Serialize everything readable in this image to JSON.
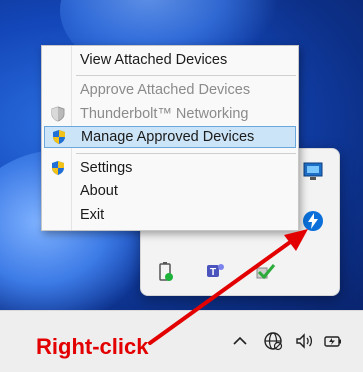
{
  "context_menu": {
    "items": [
      {
        "label": "View Attached Devices",
        "state": "enabled",
        "icon": null
      },
      {
        "label": "Approve Attached Devices",
        "state": "disabled",
        "icon": null
      },
      {
        "label": "Thunderbolt™ Networking",
        "state": "disabled",
        "icon": "shield-gray-icon"
      },
      {
        "label": "Manage Approved Devices",
        "state": "selected",
        "icon": "shield-uac-icon"
      },
      {
        "label": "Settings",
        "state": "enabled",
        "icon": "shield-uac-icon"
      },
      {
        "label": "About",
        "state": "enabled",
        "icon": null
      },
      {
        "label": "Exit",
        "state": "enabled",
        "icon": null
      }
    ]
  },
  "tray_flyout": {
    "icons": [
      "monitor-app-icon",
      "thunderbolt-icon",
      "battery-status-icon",
      "teams-icon",
      "checkmark-app-icon"
    ]
  },
  "taskbar": {
    "icons": [
      "chevron-up-icon",
      "network-globe-icon",
      "volume-icon",
      "battery-icon"
    ]
  },
  "annotation": {
    "text": "Right-click",
    "color": "#e30000"
  },
  "colors": {
    "selection": "#cce4f7",
    "selection_border": "#6aa7dc",
    "thunderbolt": "#0a6fd8"
  }
}
